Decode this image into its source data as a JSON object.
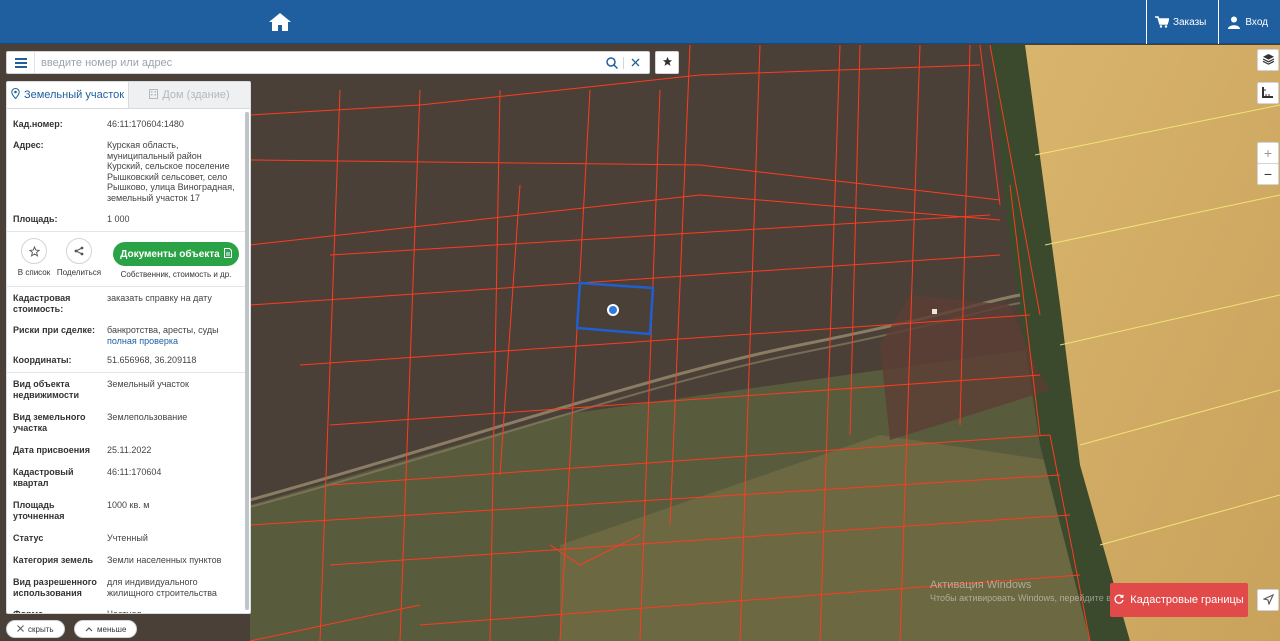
{
  "header": {
    "orders_label": "Заказы",
    "login_label": "Вход"
  },
  "search": {
    "placeholder": "введите номер или адрес"
  },
  "tabs": [
    {
      "label": "Земельный участок"
    },
    {
      "label": "Дом (здание)"
    }
  ],
  "parcel": {
    "cad_number_label": "Кад.номер:",
    "cad_number": "46:11:170604:1480",
    "address_label": "Адрес:",
    "address": "Курская область, муниципальный район Курский, сельское поселение Рышковский сельсовет, село Рышково, улица Виноградная, земельный участок 17",
    "area_label": "Площадь:",
    "area": "1 000"
  },
  "actions": {
    "to_list": "В список",
    "share": "Поделиться",
    "documents": "Документы объекта",
    "documents_sub": "Собственник, стоимость и др."
  },
  "details": {
    "cad_value_label": "Кадастровая стоимость:",
    "cad_value_link": "заказать справку на дату",
    "risks_label": "Риски при сделке:",
    "risks_text": "банкротства, аресты, суды",
    "risks_link": "полная проверка",
    "coords_label": "Координаты:",
    "coords": "51.656968, 36.209118"
  },
  "properties": [
    {
      "label": "Вид объекта недвижимости",
      "value": "Земельный участок"
    },
    {
      "label": "Вид земельного участка",
      "value": "Землепользование"
    },
    {
      "label": "Дата присвоения",
      "value": "25.11.2022"
    },
    {
      "label": "Кадастровый квартал",
      "value": "46:11:170604"
    },
    {
      "label": "Площадь уточненная",
      "value": "1000 кв. м"
    },
    {
      "label": "Статус",
      "value": "Учтенный"
    },
    {
      "label": "Категория земель",
      "value": "Земли населенных пунктов"
    },
    {
      "label": "Вид разрешенного использования",
      "value": "для индивидуального жилищного строительства"
    },
    {
      "label": "Форма собственности",
      "value": "Частная"
    }
  ],
  "bottom": {
    "hide_label": "скрыть",
    "less_label": "меньше"
  },
  "map_controls": {
    "zoom_in": "+",
    "zoom_out": "−",
    "cadastral_button": "Кадастровые границы"
  },
  "watermark": {
    "line1": "Активация Windows",
    "line2": "Чтобы активировать Windows, перейдите в раздел"
  },
  "colors": {
    "header": "#1f5fa0",
    "docs_button": "#2aa346",
    "cadastral_button": "#e24a4a",
    "parcel_lines": "#ff3b1f",
    "selected_parcel": "#1f5fd0"
  }
}
